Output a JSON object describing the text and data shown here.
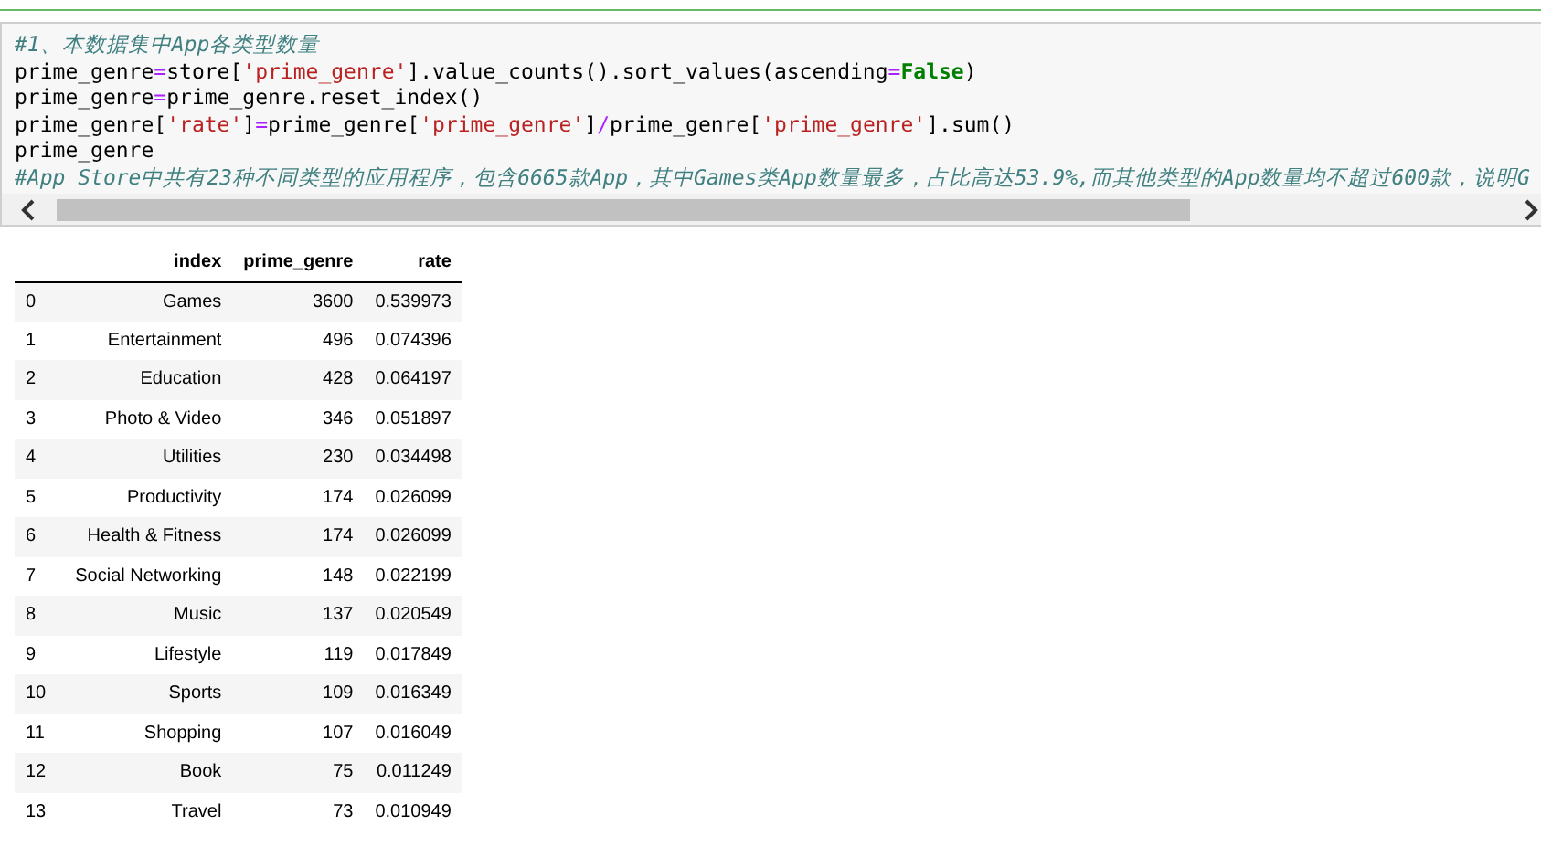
{
  "code_cell": {
    "lines": [
      [
        {
          "kind": "comment",
          "text": "#1、本数据集中App各类型数量"
        }
      ],
      [
        {
          "kind": "plain",
          "text": "prime_genre"
        },
        {
          "kind": "op",
          "text": "="
        },
        {
          "kind": "plain",
          "text": "store["
        },
        {
          "kind": "string",
          "text": "'prime_genre'"
        },
        {
          "kind": "plain",
          "text": "].value_counts().sort_values(ascending"
        },
        {
          "kind": "op",
          "text": "="
        },
        {
          "kind": "keyword",
          "text": "False"
        },
        {
          "kind": "plain",
          "text": ")"
        }
      ],
      [
        {
          "kind": "plain",
          "text": "prime_genre"
        },
        {
          "kind": "op",
          "text": "="
        },
        {
          "kind": "plain",
          "text": "prime_genre.reset_index()"
        }
      ],
      [
        {
          "kind": "plain",
          "text": "prime_genre["
        },
        {
          "kind": "string",
          "text": "'rate'"
        },
        {
          "kind": "plain",
          "text": "]"
        },
        {
          "kind": "op",
          "text": "="
        },
        {
          "kind": "plain",
          "text": "prime_genre["
        },
        {
          "kind": "string",
          "text": "'prime_genre'"
        },
        {
          "kind": "plain",
          "text": "]"
        },
        {
          "kind": "op",
          "text": "/"
        },
        {
          "kind": "plain",
          "text": "prime_genre["
        },
        {
          "kind": "string",
          "text": "'prime_genre'"
        },
        {
          "kind": "plain",
          "text": "].sum()"
        }
      ],
      [
        {
          "kind": "plain",
          "text": "prime_genre"
        }
      ],
      [
        {
          "kind": "comment",
          "text": "#App Store中共有23种不同类型的应用程序，包含6665款App，其中Games类App数量最多，占比高达53.9%,而其他类型的App数量均不超过600款，说明G"
        }
      ]
    ]
  },
  "table": {
    "columns": [
      "",
      "index",
      "prime_genre",
      "rate"
    ],
    "rows": [
      [
        "0",
        "Games",
        "3600",
        "0.539973"
      ],
      [
        "1",
        "Entertainment",
        "496",
        "0.074396"
      ],
      [
        "2",
        "Education",
        "428",
        "0.064197"
      ],
      [
        "3",
        "Photo & Video",
        "346",
        "0.051897"
      ],
      [
        "4",
        "Utilities",
        "230",
        "0.034498"
      ],
      [
        "5",
        "Productivity",
        "174",
        "0.026099"
      ],
      [
        "6",
        "Health & Fitness",
        "174",
        "0.026099"
      ],
      [
        "7",
        "Social Networking",
        "148",
        "0.022199"
      ],
      [
        "8",
        "Music",
        "137",
        "0.020549"
      ],
      [
        "9",
        "Lifestyle",
        "119",
        "0.017849"
      ],
      [
        "10",
        "Sports",
        "109",
        "0.016349"
      ],
      [
        "11",
        "Shopping",
        "107",
        "0.016049"
      ],
      [
        "12",
        "Book",
        "75",
        "0.011249"
      ],
      [
        "13",
        "Travel",
        "73",
        "0.010949"
      ]
    ]
  }
}
